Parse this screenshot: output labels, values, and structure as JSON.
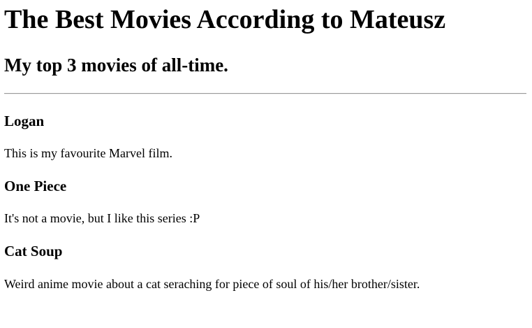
{
  "page": {
    "title": "The Best Movies According to Mateusz",
    "subtitle": "My top 3 movies of all-time."
  },
  "movies": [
    {
      "title": "Logan",
      "description": "This is my favourite Marvel film."
    },
    {
      "title": "One Piece",
      "description": "It's not a movie, but I like this series :P"
    },
    {
      "title": "Cat Soup",
      "description": "Weird anime movie about a cat seraching for piece of soul of his/her brother/sister."
    }
  ]
}
